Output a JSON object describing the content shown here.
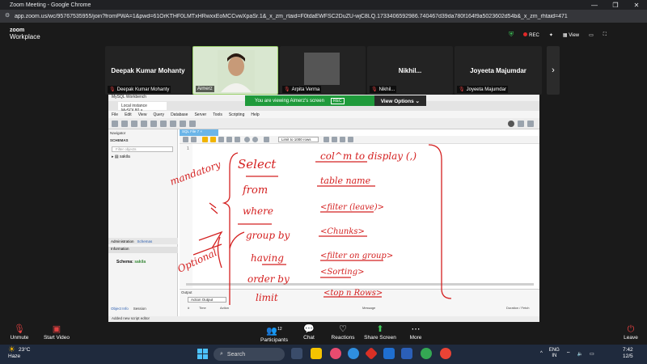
{
  "browser": {
    "title": "Zoom Meeting - Google Chrome",
    "url": "app.zoom.us/wc/95767535955/join?fromPWA=1&pwd=61OrKTHF0LMTxHRwxxEoMCCvwXpaSr.1&_x_zm_rtaid=F0tdaEWFSC2DuZU-wjC8LQ.1733406592986.740467d39da780f164f9a5023602d54b&_x_zm_rhtaid=471"
  },
  "zoom": {
    "logo_line1": "zoom",
    "logo_line2": "Workplace",
    "rec_label": "REC",
    "view_label": "View",
    "participants": [
      {
        "center": "Deepak Kumar Mohanty",
        "label": "Deepak Kumar Mohanty",
        "muted": true
      },
      {
        "center": "",
        "label": "Aimerz",
        "muted": false
      },
      {
        "center": "",
        "label": "Arpita Verma",
        "muted": true
      },
      {
        "center": "Nikhil...",
        "label": "Nikhil...",
        "muted": true
      },
      {
        "center": "Joyeeta Majumdar",
        "label": "Joyeeta Majumdar",
        "muted": true
      }
    ],
    "share_banner": {
      "text": "You are viewing  Aimerz's screen",
      "rec": "REC",
      "view_options": "View Options ⌄"
    },
    "toolbar": {
      "unmute": "Unmute",
      "start_video": "Start Video",
      "participants": "Participants",
      "participants_count": "12",
      "chat": "Chat",
      "reactions": "Reactions",
      "share_screen": "Share Screen",
      "more": "More",
      "leave": "Leave"
    }
  },
  "workbench": {
    "title": "MySQL Workbench",
    "tab": "Local instance MySQL80 ×",
    "menu": [
      "File",
      "Edit",
      "View",
      "Query",
      "Database",
      "Server",
      "Tools",
      "Scripting",
      "Help"
    ],
    "navigator": "Navigator",
    "schemas": "SCHEMAS",
    "filter_placeholder": "Filter objects",
    "schema_item": "sakila",
    "side_tabs": [
      "Administration",
      "Schemas"
    ],
    "information": "Information",
    "schema_label": "Schema:",
    "schema_value": "sakila",
    "bottom_tabs": [
      "Object Info",
      "Session"
    ],
    "editor_tab": "SQL File 7 ×",
    "limit": "Limit to 1000 rows",
    "line_no": "1",
    "output": "Output",
    "action_output": "Action Output",
    "out_cols": [
      "#",
      "Time",
      "Action",
      "Message",
      "Duration / Fetch"
    ],
    "status": "Added new script editor"
  },
  "annotations": {
    "left": [
      "mandatory",
      "Optional"
    ],
    "keywords": [
      "Select",
      "from",
      "where",
      "group by",
      "having",
      "order by",
      "limit"
    ],
    "notes": [
      "col^m to display (,)",
      "table name",
      "<filter (leave)>",
      "<Chunks>",
      "<filter on group>",
      "<Sorting>",
      "<top n Rows>"
    ]
  },
  "taskbar": {
    "temp": "23°C",
    "weather": "Haze",
    "search": "Search",
    "lang1": "ENG",
    "lang2": "IN",
    "time": "7:42",
    "date": "12/5"
  }
}
